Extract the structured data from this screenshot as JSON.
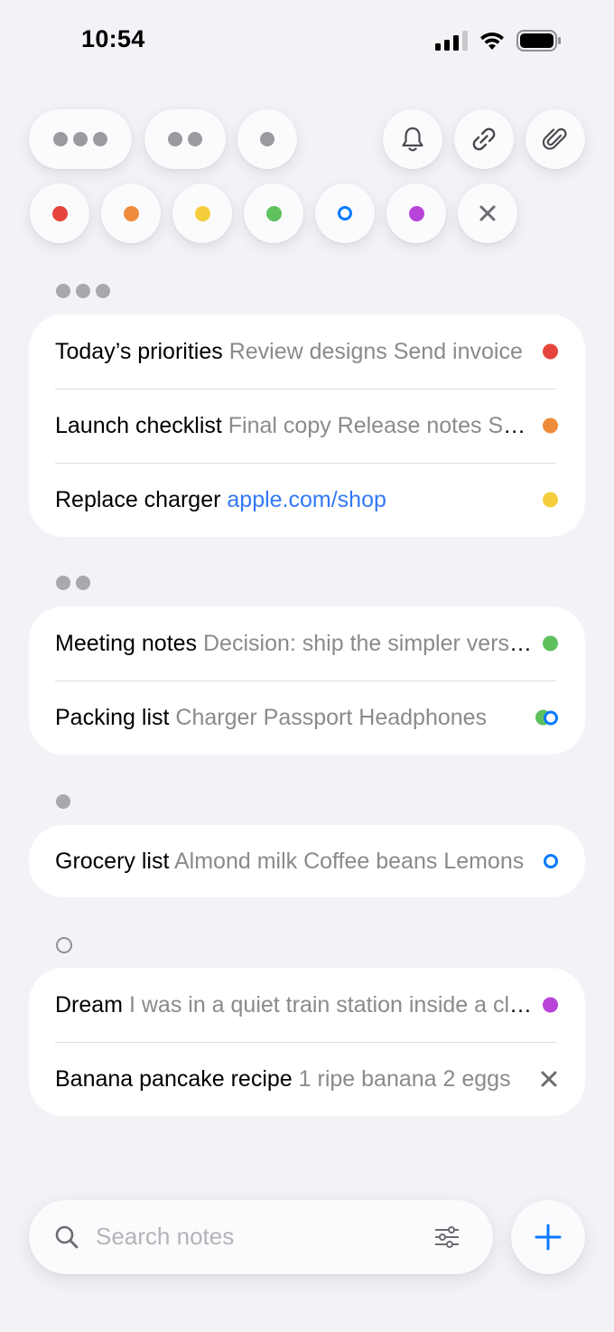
{
  "status_bar": {
    "time": "10:54"
  },
  "colors": {
    "red": "#e5453d",
    "orange": "#ef8c3c",
    "yellow": "#f4ce3c",
    "green": "#5ec15e",
    "blue": "#0a7aff",
    "purple": "#b843d8",
    "gray": "#9a9a9f"
  },
  "toolbar": {
    "priority_filters": [
      "priority-3",
      "priority-2",
      "priority-1"
    ],
    "actions": [
      "bell-icon",
      "link-icon",
      "paperclip-icon"
    ],
    "color_filters": [
      "red",
      "orange",
      "yellow",
      "green",
      "blue-ring",
      "purple",
      "clear"
    ]
  },
  "sections": [
    {
      "priority": 3,
      "notes": [
        {
          "title": "Today’s priorities",
          "preview": "Review designs Send invoice",
          "mark": "red"
        },
        {
          "title": "Launch checklist",
          "preview": "Final copy Release notes Screenshots",
          "mark": "orange"
        },
        {
          "title": "Replace charger",
          "link": "apple.com/shop",
          "mark": "yellow"
        }
      ]
    },
    {
      "priority": 2,
      "notes": [
        {
          "title": "Meeting notes",
          "preview": "Decision: ship the simpler version",
          "mark": "green"
        },
        {
          "title": "Packing list",
          "preview": "Charger Passport Headphones",
          "mark": "green+blue-ring"
        }
      ]
    },
    {
      "priority": 1,
      "notes": [
        {
          "title": "Grocery list",
          "preview": "Almond milk Coffee beans Lemons",
          "mark": "blue-ring"
        }
      ]
    },
    {
      "priority": 0,
      "notes": [
        {
          "title": "Dream",
          "preview": "I was in a quiet train station inside a cloud",
          "mark": "purple"
        },
        {
          "title": "Banana pancake recipe",
          "preview": "1 ripe banana 2 eggs",
          "mark": "x"
        }
      ]
    }
  ],
  "search": {
    "placeholder": "Search notes"
  }
}
